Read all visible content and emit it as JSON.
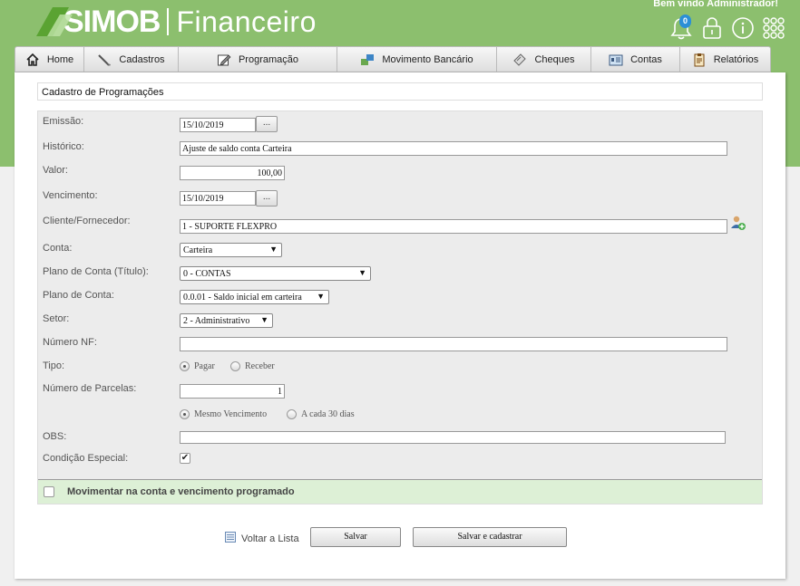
{
  "header": {
    "brand_logo": "SIMOB",
    "brand_product": "Financeiro",
    "welcome": "Bem vindo Administrador!",
    "notifications_count": "0",
    "icons": [
      "bell-icon",
      "lock-icon",
      "info-icon",
      "apps-grid-icon"
    ]
  },
  "nav": {
    "items": [
      {
        "label": "Home",
        "icon": "home-icon"
      },
      {
        "label": "Cadastros",
        "icon": "pencil-icon"
      },
      {
        "label": "Programação",
        "icon": "edit-icon"
      },
      {
        "label": "Movimento Bancário",
        "icon": "transfer-icon"
      },
      {
        "label": "Cheques",
        "icon": "cheque-icon"
      },
      {
        "label": "Contas",
        "icon": "accounts-icon"
      },
      {
        "label": "Relatórios",
        "icon": "report-icon"
      }
    ]
  },
  "page": {
    "title": "Cadastro de Programações"
  },
  "form": {
    "emissao_label": "Emissão:",
    "emissao_value": "15/10/2019",
    "picker_label": "...",
    "historico_label": "Histórico:",
    "historico_value": "Ajuste de saldo conta Carteira",
    "valor_label": "Valor:",
    "valor_value": "100,00",
    "vencimento_label": "Vencimento:",
    "vencimento_value": "15/10/2019",
    "cliente_label": "Cliente/Fornecedor:",
    "cliente_value": "1 - SUPORTE FLEXPRO",
    "conta_label": "Conta:",
    "conta_value": "Carteira",
    "plano_titulo_label": "Plano de Conta (Título):",
    "plano_titulo_value": "0 - CONTAS",
    "plano_label": "Plano de Conta:",
    "plano_value": "0.0.01 - Saldo inicial em carteira",
    "setor_label": "Setor:",
    "setor_value": "2 - Administrativo",
    "nf_label": "Número NF:",
    "nf_value": "",
    "tipo_label": "Tipo:",
    "tipo_pagar": "Pagar",
    "tipo_receber": "Receber",
    "tipo_selected": "Pagar",
    "parcelas_label": "Número de Parcelas:",
    "parcelas_value": "1",
    "venc_mesmo": "Mesmo Vencimento",
    "venc_30": "A cada 30 dias",
    "venc_selected": "Mesmo Vencimento",
    "obs_label": "OBS:",
    "obs_value": "",
    "condicao_label": "Condição Especial:",
    "condicao_checked": true,
    "movimentar_label": "Movimentar na conta e vencimento programado",
    "movimentar_checked": false
  },
  "footer": {
    "back_label": "Voltar a Lista",
    "save_label": "Salvar",
    "save_new_label": "Salvar e cadastrar"
  },
  "colors": {
    "header_green": "#8cbf6e",
    "strip_green": "#ddf0d6",
    "badge_blue": "#2b8fd6"
  }
}
